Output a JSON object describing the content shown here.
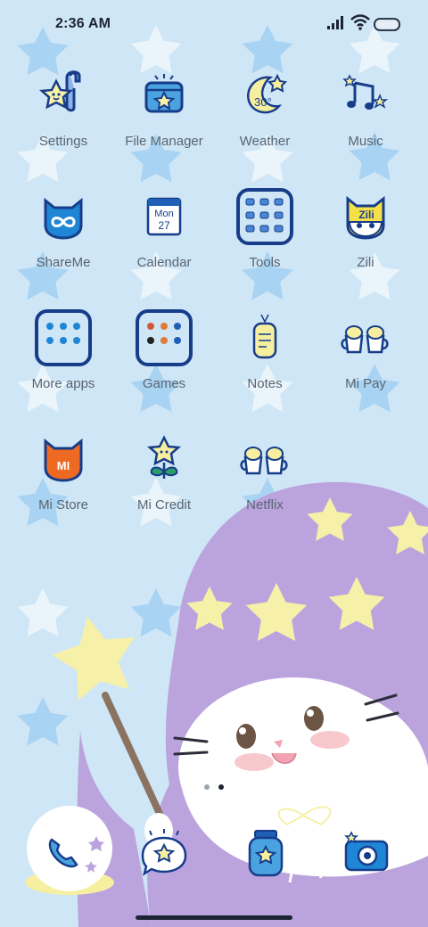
{
  "status_bar": {
    "time": "2:36 AM",
    "icons": [
      "signal-icon",
      "wifi-icon",
      "battery-icon"
    ]
  },
  "apps": [
    {
      "label": "Settings",
      "icon": "star-wrench-icon"
    },
    {
      "label": "File Manager",
      "icon": "folder-star-icon"
    },
    {
      "label": "Weather",
      "icon": "moon-star-icon",
      "badge": "30°"
    },
    {
      "label": "Music",
      "icon": "music-notes-icon"
    },
    {
      "label": "ShareMe",
      "icon": "cat-share-icon"
    },
    {
      "label": "Calendar",
      "icon": "calendar-icon",
      "month": "Mon",
      "day": "27"
    },
    {
      "label": "Tools",
      "icon": "folder-grid-icon"
    },
    {
      "label": "Zili",
      "icon": "zili-cat-icon",
      "badge": "Zili"
    },
    {
      "label": "More apps",
      "icon": "folder-grid-icon"
    },
    {
      "label": "Games",
      "icon": "folder-grid-icon"
    },
    {
      "label": "Notes",
      "icon": "tag-note-icon"
    },
    {
      "label": "Mi Pay",
      "icon": "mugs-icon"
    },
    {
      "label": "Mi Store",
      "icon": "mi-cat-icon",
      "badge": "MI"
    },
    {
      "label": "Mi Credit",
      "icon": "star-flower-icon"
    },
    {
      "label": "Netflix",
      "icon": "mugs-icon"
    }
  ],
  "dock": [
    {
      "name": "phone",
      "icon": "phone-globe-icon"
    },
    {
      "name": "messages",
      "icon": "chat-star-icon"
    },
    {
      "name": "browser",
      "icon": "jar-icon"
    },
    {
      "name": "camera",
      "icon": "camera-icon"
    }
  ],
  "pages": {
    "count": 2,
    "current": 2
  },
  "colors": {
    "background": "#cfe6f6",
    "star_blue": "#a9d3f2",
    "star_white": "#eaf4fb",
    "hat_purple": "#bba4de",
    "star_yellow": "#f6f0a8",
    "icon_outline": "#173d8a",
    "label_gray": "#5a6572"
  }
}
